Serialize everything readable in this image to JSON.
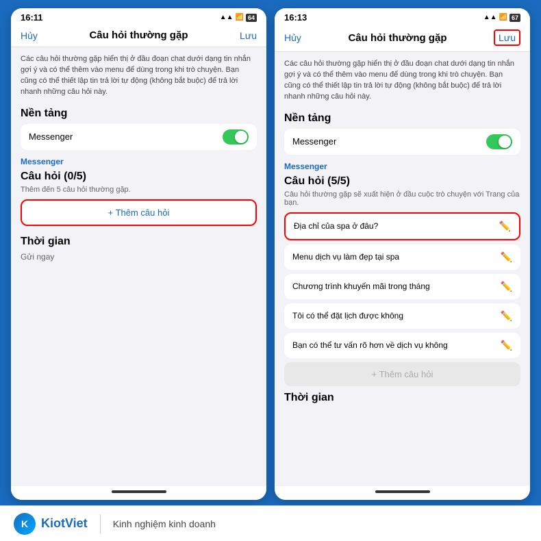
{
  "left_phone": {
    "status_bar": {
      "time": "16:11",
      "signal": "▲▲▲",
      "wifi": "wifi",
      "battery": "64"
    },
    "nav": {
      "cancel": "Hủy",
      "title": "Câu hỏi thường gặp",
      "save": "Lưu",
      "save_highlighted": false
    },
    "description": "Các câu hỏi thường gặp hiển thị ở đầu đoạn chat dưới dạng tin nhắn gợi ý và có thể thêm vào menu để dùng trong khi trò chuyện. Bạn cũng có thể thiết lập tin trả lời tự động (không bắt buộc) để trả lời nhanh những câu hỏi này.",
    "platform_header": "Nền tảng",
    "messenger_label": "Messenger",
    "toggle_on": true,
    "section_label": "Messenger",
    "questions_header": "Câu hỏi (0/5)",
    "questions_sub": "Thêm đến 5 câu hỏi thường gặp.",
    "add_btn": "+ Thêm câu hỏi",
    "add_btn_highlighted": true,
    "time_header": "Thời gian",
    "time_value": "Gửi ngay"
  },
  "right_phone": {
    "status_bar": {
      "time": "16:13",
      "signal": "▲▲▲",
      "wifi": "wifi",
      "battery": "67"
    },
    "nav": {
      "cancel": "Hủy",
      "title": "Câu hỏi thường gặp",
      "save": "Lưu",
      "save_highlighted": true
    },
    "description": "Các câu hỏi thường gặp hiển thị ở đầu đoạn chat dưới dạng tin nhắn gợi ý và có thể thêm vào menu để dùng trong khi trò chuyện. Bạn cũng có thể thiết lập tin trả lời tự động (không bắt buộc) để trả lời nhanh những câu hỏi này.",
    "platform_header": "Nền tảng",
    "messenger_label": "Messenger",
    "toggle_on": true,
    "section_label": "Messenger",
    "questions_header": "Câu hỏi (5/5)",
    "questions_sub": "Câu hỏi thường gặp sẽ xuất hiện ở đầu cuộc trò chuyện với Trang của bạn.",
    "questions": [
      {
        "text": "Địa chỉ của spa ở đâu?",
        "highlighted": true
      },
      {
        "text": "Menu dịch vụ làm đẹp tại spa",
        "highlighted": false
      },
      {
        "text": "Chương trình khuyến mãi trong tháng",
        "highlighted": false
      },
      {
        "text": "Tôi có thể đặt lịch được không",
        "highlighted": false
      },
      {
        "text": "Bạn có thể tư vấn rõ hơn về dịch vụ không",
        "highlighted": false
      }
    ],
    "add_btn": "+ Thêm câu hỏi",
    "add_btn_disabled": true,
    "time_header": "Thời gian"
  },
  "footer": {
    "brand_name": "KiotViet",
    "tagline": "Kinh nghiệm kinh doanh"
  }
}
